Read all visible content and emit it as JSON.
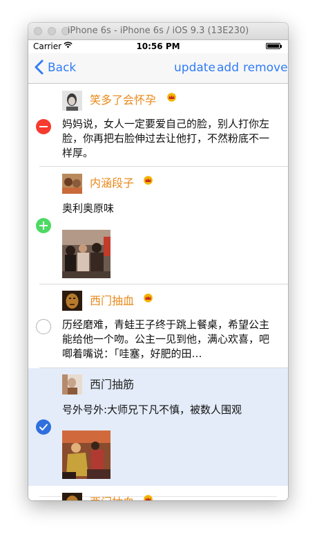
{
  "window": {
    "title": "iPhone 6s - iPhone 6s / iOS 9.3 (13E230)"
  },
  "status_bar": {
    "carrier": "Carrier",
    "time": "10:56 PM"
  },
  "nav": {
    "back_label": "Back",
    "update_label": "update",
    "add_label": "add",
    "remove_label": "remove"
  },
  "posts": [
    {
      "user": "笑多了会怀孕",
      "vip": true,
      "text": "妈妈说，女人一定要爱自己的脸，别人打你左脸，你再把右脸伸过去让他打，不然粉底不一样厚。",
      "edit_state": "delete",
      "selected": false
    },
    {
      "user": "内涵段子",
      "vip": true,
      "text": "奥利奥原味",
      "edit_state": "insert",
      "selected": false,
      "has_image": true
    },
    {
      "user": "西门抽血",
      "vip": true,
      "text": "历经磨难，青蛙王子终于跳上餐桌，希望公主能给他一个吻。公主一见到他，满心欢喜，吧唧着嘴说：「哇塞，好肥的田…",
      "edit_state": "unselected",
      "selected": false
    },
    {
      "user": "西门抽筋",
      "vip": false,
      "text": "号外号外:大师兄下凡不慎，被数人围观",
      "edit_state": "checked",
      "selected": true,
      "has_image": true
    },
    {
      "user": "西门抽血",
      "vip": true
    }
  ],
  "colors": {
    "accent": "#2f7cf6",
    "username": "#e8891b",
    "delete": "#f63a2f",
    "insert": "#4cd964",
    "check": "#2f6fde",
    "selected_bg": "#e4ecf9"
  }
}
